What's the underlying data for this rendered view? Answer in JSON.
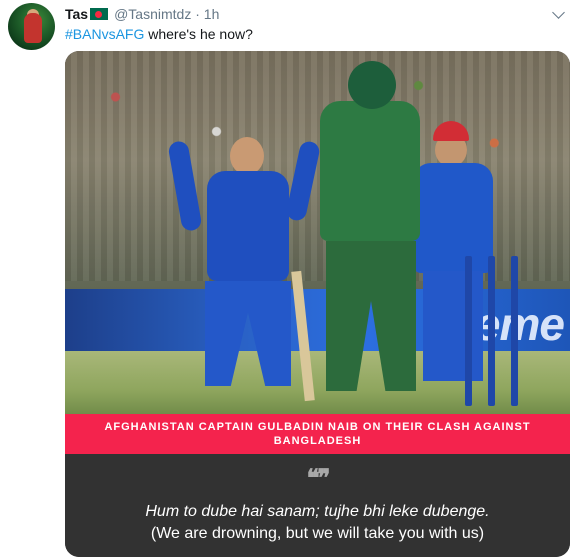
{
  "tweet": {
    "author_name": "Tas",
    "author_handle": "@Tasnimtdz",
    "separator": "·",
    "time": "1h",
    "hashtag": "#BANvsAFG",
    "text": " where's he now?",
    "flag_icon": "bangladesh-flag-icon",
    "menu_icon": "chevron-down-icon"
  },
  "media": {
    "board_text": "eme",
    "caption": "AFGHANISTAN CAPTAIN GULBADIN NAIB ON THEIR CLASH AGAINST BANGLADESH",
    "quote_mark": "❝❞",
    "quote_line1": "Hum to dube hai sanam; tujhe bhi leke dubenge.",
    "quote_line2": "(We are drowning, but we will take you with us)"
  },
  "colors": {
    "hashtag": "#1b95e0",
    "caption_bar": "#f4234d",
    "quote_bg": "#323232"
  }
}
